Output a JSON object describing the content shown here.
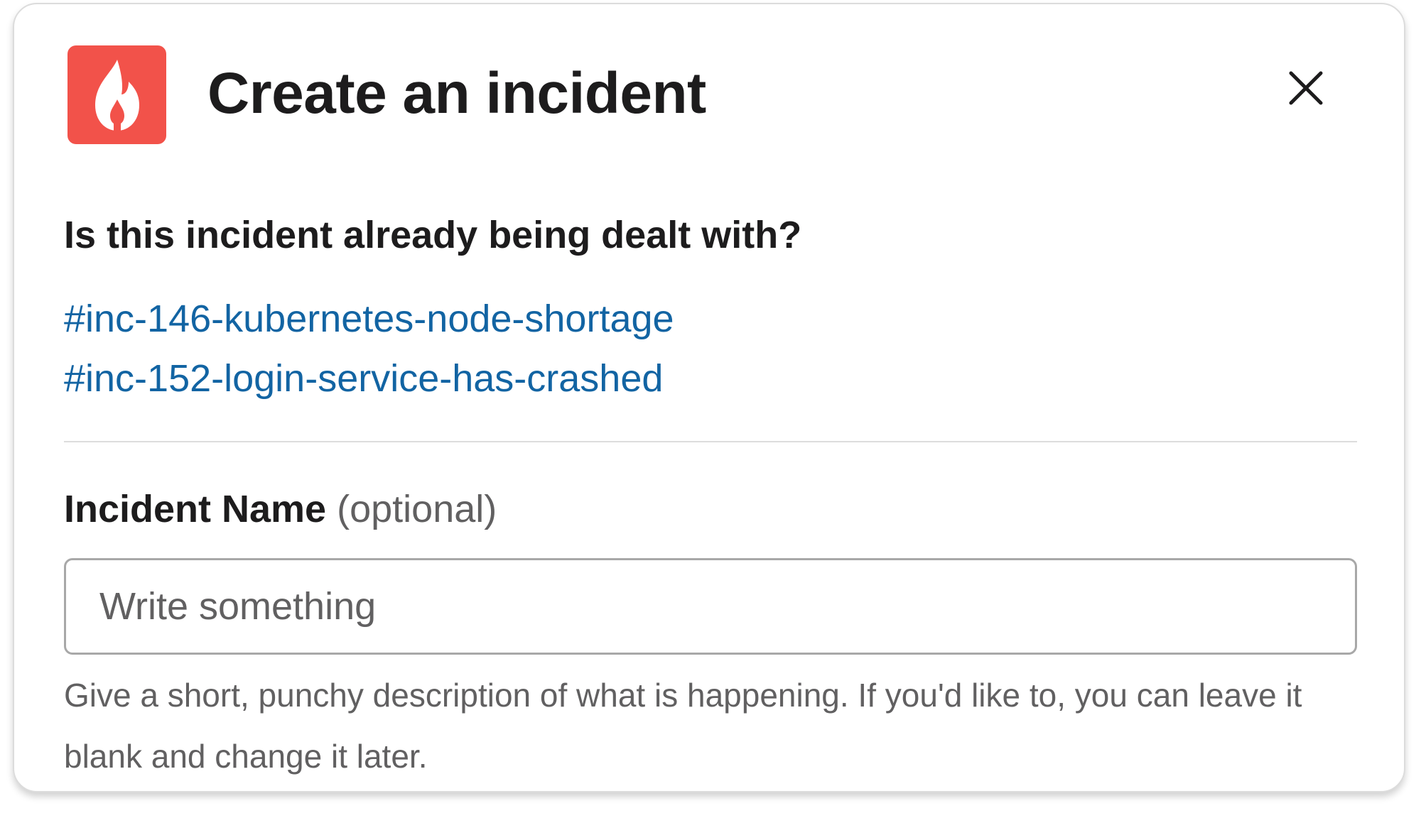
{
  "header": {
    "title": "Create an incident",
    "icon": "fire-icon",
    "icon_bg": "#f2524a",
    "close_icon": "close-icon"
  },
  "existing": {
    "question": "Is this incident already being dealt with?",
    "links": [
      "#inc-146-kubernetes-node-shortage",
      "#inc-152-login-service-has-crashed"
    ],
    "link_color": "#1264a3"
  },
  "incident_name": {
    "label": "Incident Name",
    "optional": "(optional)",
    "placeholder": "Write something",
    "value": "",
    "hint": "Give a short, punchy description of what is happening. If you'd like to, you can leave it blank and change it later."
  }
}
